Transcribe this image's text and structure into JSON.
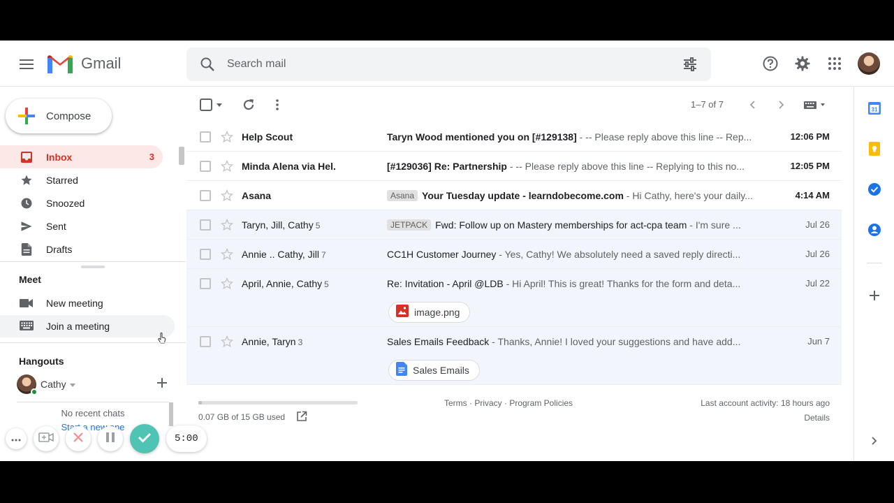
{
  "header": {
    "app_name": "Gmail",
    "search_placeholder": "Search mail"
  },
  "sidebar": {
    "compose_label": "Compose",
    "items": [
      {
        "label": "Inbox",
        "count": "3",
        "icon": "inbox-icon",
        "active": true
      },
      {
        "label": "Starred",
        "count": "",
        "icon": "star-icon"
      },
      {
        "label": "Snoozed",
        "count": "",
        "icon": "clock-icon"
      },
      {
        "label": "Sent",
        "count": "",
        "icon": "send-icon"
      },
      {
        "label": "Drafts",
        "count": "",
        "icon": "draft-icon"
      }
    ],
    "meet": {
      "title": "Meet",
      "new_meeting": "New meeting",
      "join_meeting": "Join a meeting"
    },
    "hangouts": {
      "title": "Hangouts",
      "user": "Cathy",
      "no_chats": "No recent chats",
      "start_new": "Start a new one"
    }
  },
  "recorder": {
    "timer": "5:00"
  },
  "toolbar": {
    "pager": "1–7 of 7"
  },
  "emails": [
    {
      "sender": "Help Scout",
      "count": "",
      "label": "",
      "subject": "Taryn Wood mentioned you on [#129138]",
      "snippet": " - -- Please reply above this line -- Rep...",
      "date": "12:06 PM",
      "unread": true
    },
    {
      "sender": "Minda Alena via Hel.",
      "count": "",
      "label": "",
      "subject": "[#129036] Re: Partnership",
      "snippet": " - -- Please reply above this line -- Replying to this no...",
      "date": "12:05 PM",
      "unread": true
    },
    {
      "sender": "Asana",
      "count": "",
      "label": "Asana",
      "subject": "Your Tuesday update - learndobecome.com",
      "snippet": " - Hi Cathy, here's your daily...",
      "date": "4:14 AM",
      "unread": true
    },
    {
      "sender": "Taryn, Jill, Cathy",
      "count": "5",
      "label": "JETPACK",
      "subject": "Fwd: Follow up on Mastery memberships for act-cpa team",
      "snippet": " - I'm sure ...",
      "date": "Jul 26",
      "unread": false
    },
    {
      "sender": "Annie .. Cathy, Jill",
      "count": "7",
      "label": "",
      "subject": "CC1H Customer Journey",
      "snippet": " - Yes, Cathy! We absolutely need a saved reply directi...",
      "date": "Jul 26",
      "unread": false
    },
    {
      "sender": "April, Annie, Cathy",
      "count": "5",
      "label": "",
      "subject": "Re: Invitation - April @LDB",
      "snippet": " - Hi April! This is great! Thanks for the form and deta...",
      "date": "Jul 22",
      "unread": false,
      "attachment": "image.png",
      "attachment_type": "image"
    },
    {
      "sender": "Annie, Taryn",
      "count": "3",
      "label": "",
      "subject": "Sales Emails Feedback",
      "snippet": " - Thanks, Annie! I loved your suggestions and have add...",
      "date": "Jun 7",
      "unread": false,
      "attachment": "Sales Emails",
      "attachment_type": "doc"
    }
  ],
  "footer": {
    "storage": "0.07 GB of 15 GB used",
    "storage_fraction": 0.005,
    "links": "Terms · Privacy · Program Policies",
    "activity": "Last account activity: 18 hours ago",
    "details": "Details"
  },
  "colors": {
    "accent_red": "#d93025",
    "inbox_bg": "#fce8e6",
    "read_row_bg": "#f2f6fc",
    "recorder_check": "#4fc3b4"
  }
}
